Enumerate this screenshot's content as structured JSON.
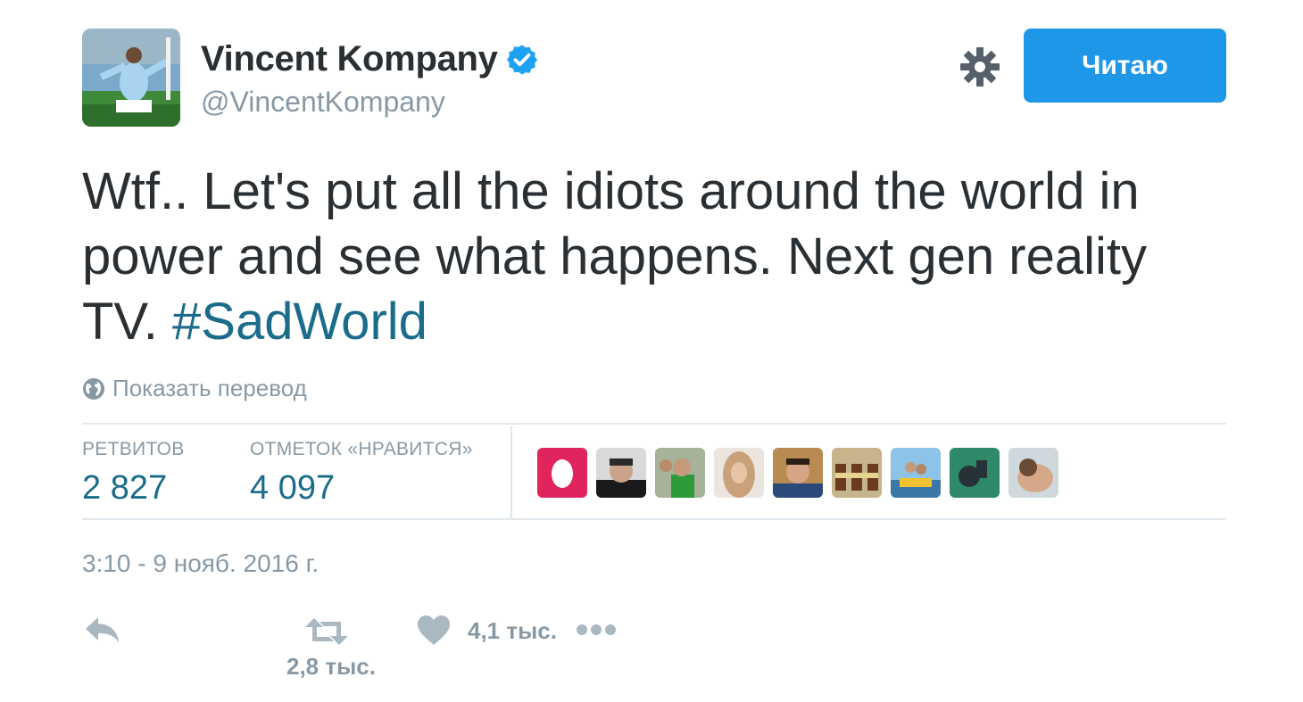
{
  "author": {
    "name": "Vincent Kompany",
    "handle": "@VincentKompany",
    "verified": true
  },
  "header": {
    "follow_label": "Читаю"
  },
  "tweet": {
    "text": "Wtf.. Let's put all the idiots around the world in power and see what happens. Next gen reality TV. ",
    "hashtag": "#SadWorld",
    "translate_label": "Показать перевод"
  },
  "stats": {
    "retweets_label": "РЕТВИТОВ",
    "retweets_value": "2 827",
    "likes_label": "ОТМЕТОК «НРАВИТСЯ»",
    "likes_value": "4 097"
  },
  "timestamp": "3:10 - 9 нояб. 2016 г.",
  "actions": {
    "retweet_count": "2,8 тыс.",
    "like_count": "4,1 тыс."
  },
  "icons": [
    "reply-icon",
    "retweet-icon",
    "heart-icon",
    "more-icon",
    "gear-icon",
    "globe-icon",
    "verified-badge-icon"
  ],
  "colors": {
    "accent": "#1f97e8",
    "link": "#1b6c8a",
    "muted": "#8899a6",
    "text": "#292f33",
    "border": "#e1e8ed"
  }
}
